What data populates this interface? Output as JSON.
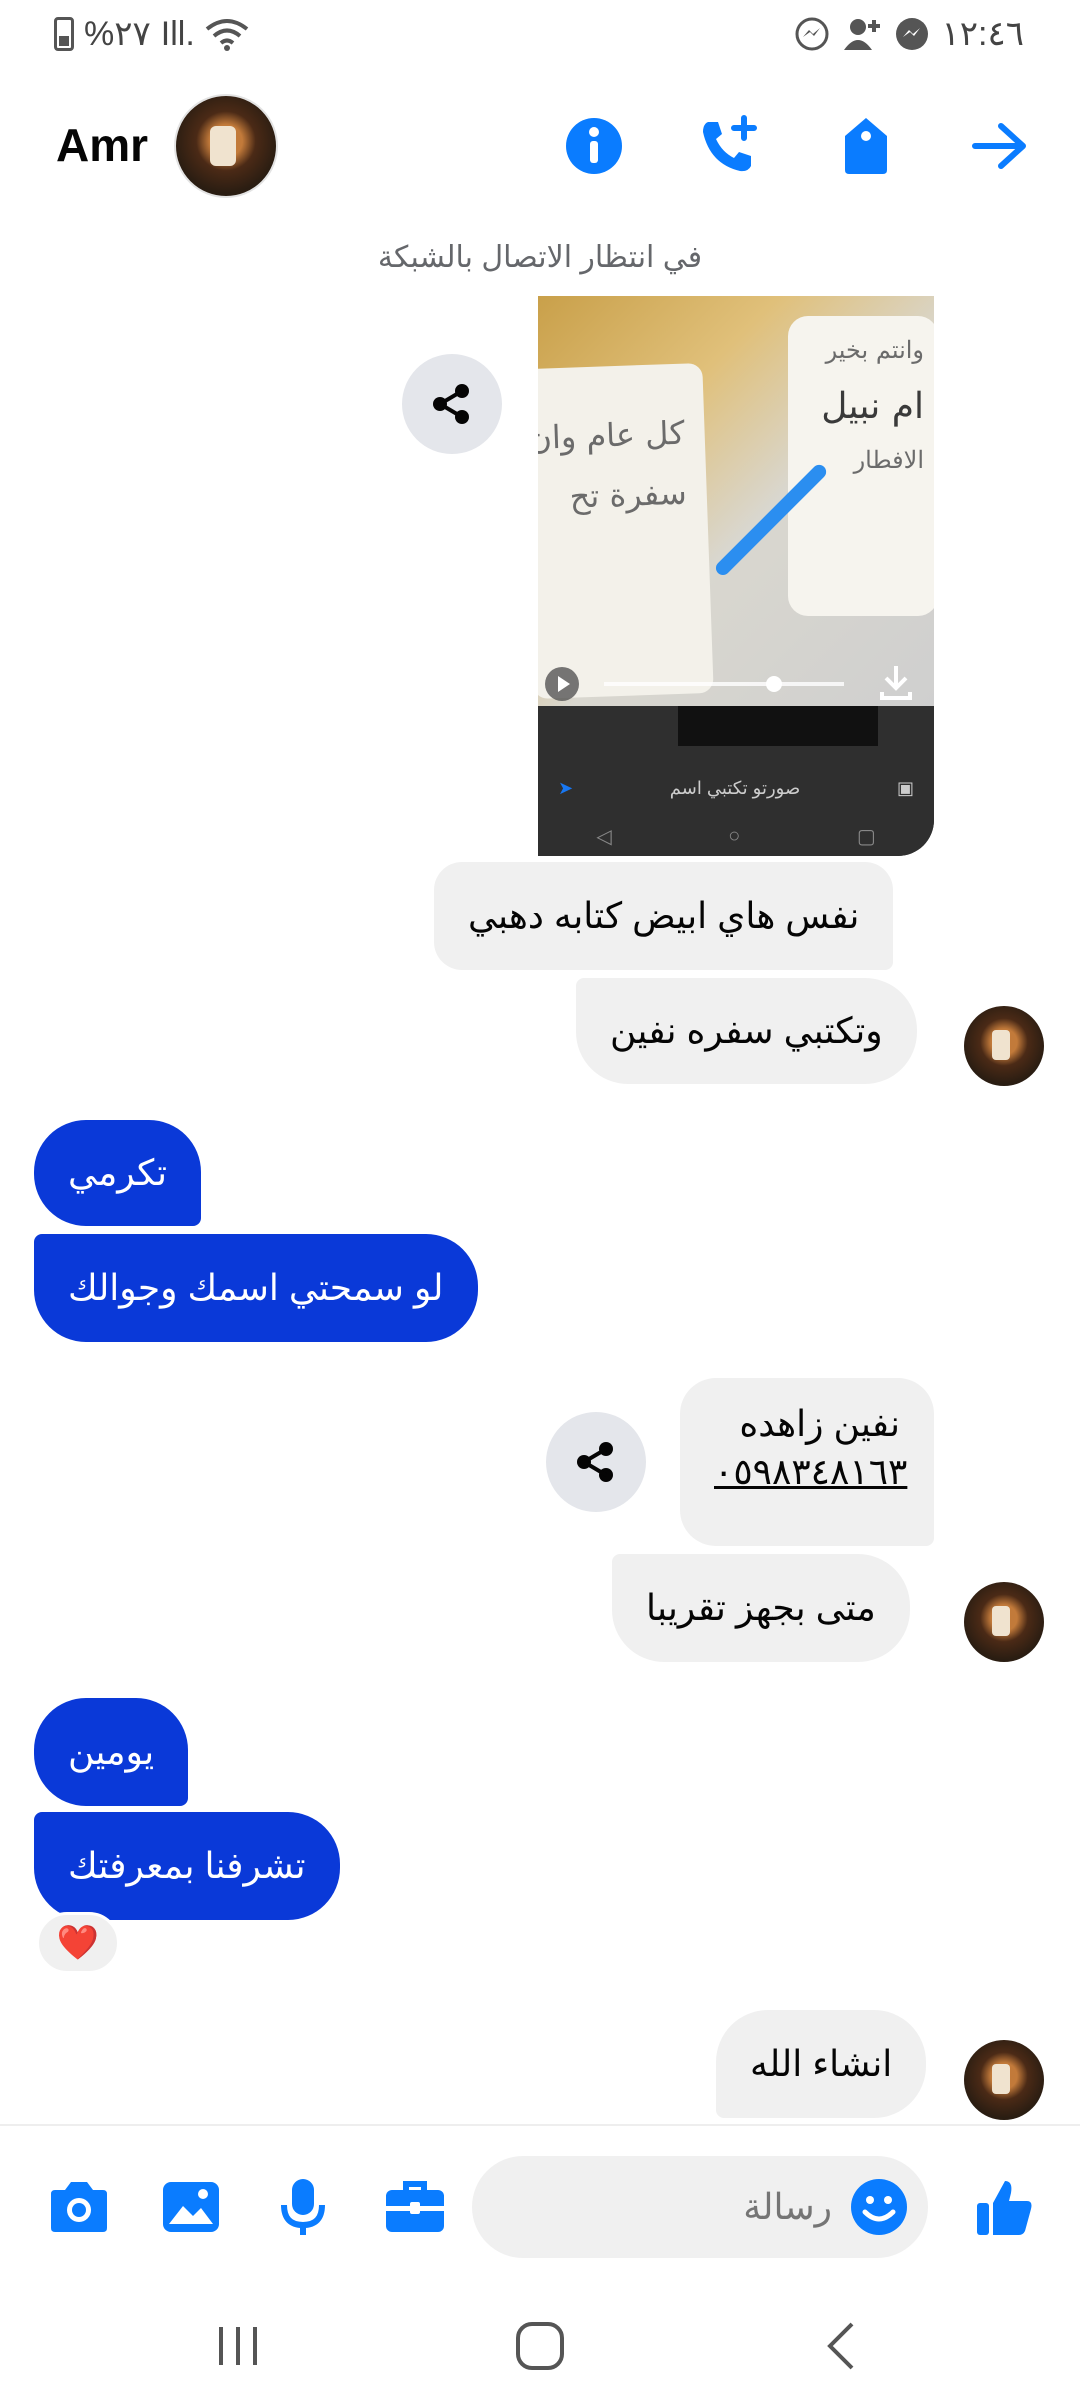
{
  "status_bar": {
    "left_text": "%٢٧",
    "signal_text": "Ill.",
    "time": "١٢:٤٦"
  },
  "header": {
    "contact_name": "Amr",
    "icons": [
      "info-icon",
      "add-call-icon",
      "tag-icon",
      "forward-arrow-icon"
    ]
  },
  "connection_status": "في انتظار الاتصال بالشبكة",
  "media": {
    "card_left_line1": "كل عام وان",
    "card_left_line2": "سفرة تح",
    "card_right_line1": "وانتم بخير",
    "card_right_line2": "ام نبيل",
    "card_right_line3": "الافطار",
    "composer_hint": "صورتو تكتبي اسم"
  },
  "messages": [
    {
      "id": "m1",
      "text": "نفس هاي ابيض كتابه دهبي",
      "side": "in"
    },
    {
      "id": "m2",
      "text": "وتكتبي سفره نفين",
      "side": "in"
    },
    {
      "id": "m3",
      "text": "تكرمي",
      "side": "out"
    },
    {
      "id": "m4",
      "text": "لو سمحتي اسمك وجوالك",
      "side": "out"
    },
    {
      "id": "m5_name",
      "text": "نفين زاهده",
      "side": "in"
    },
    {
      "id": "m5_phone",
      "text": "٠٥٩٨٣٤٨١٦٣",
      "side": "in"
    },
    {
      "id": "m6",
      "text": "متى بجهز تقريبا",
      "side": "in"
    },
    {
      "id": "m7",
      "text": "يومين",
      "side": "out"
    },
    {
      "id": "m8",
      "text": "تشرفنا بمعرفتك",
      "side": "out"
    },
    {
      "id": "m9",
      "text": "انشاء الله",
      "side": "in"
    }
  ],
  "reaction": "❤️",
  "composer": {
    "placeholder": "رسالة",
    "icons": [
      "camera-icon",
      "gallery-icon",
      "microphone-icon",
      "toolbox-icon",
      "emoji-icon",
      "like-icon"
    ]
  },
  "colors": {
    "accent": "#0a7cff",
    "outgoing_bubble": "#0a39d8",
    "incoming_bubble": "#f0f0f0"
  }
}
